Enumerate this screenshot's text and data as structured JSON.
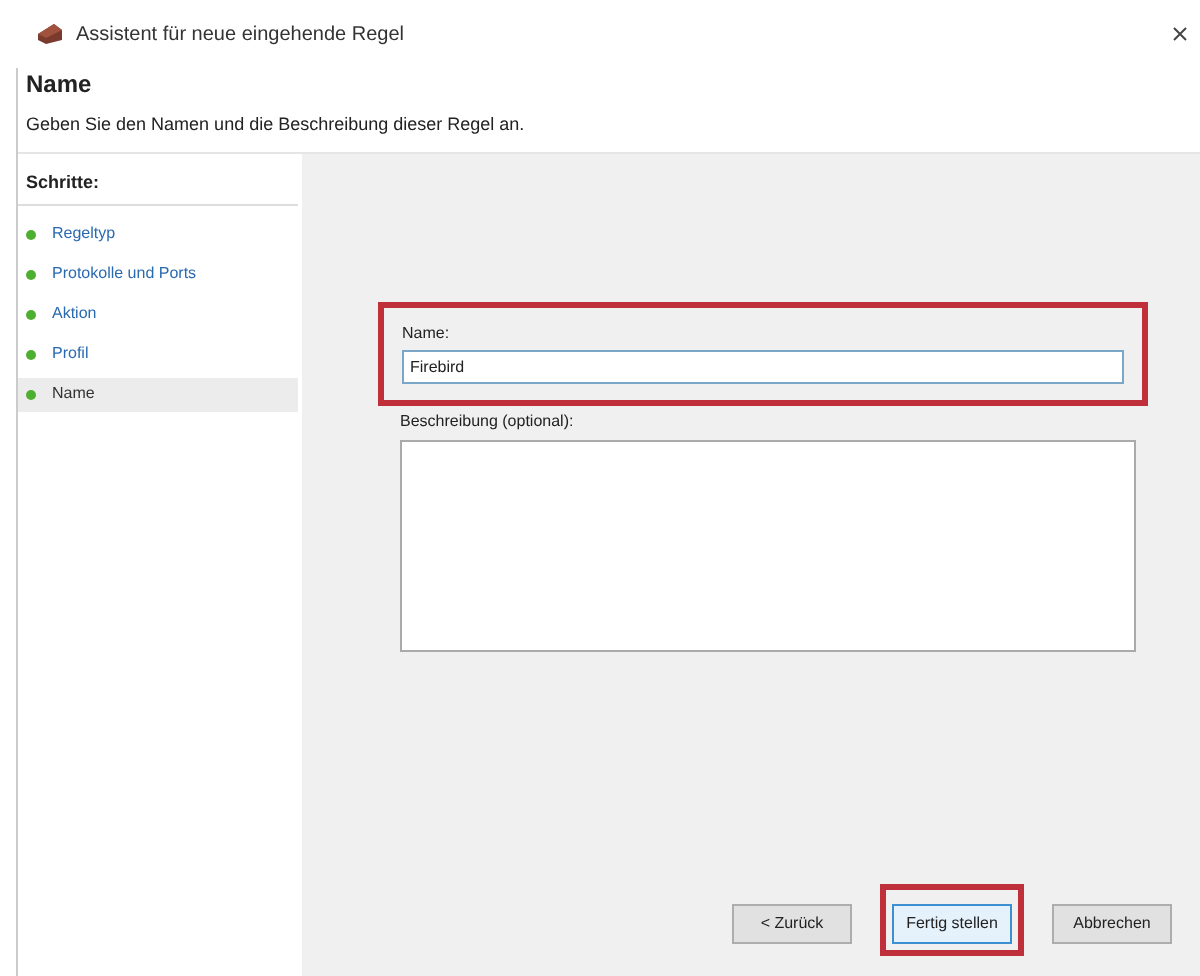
{
  "window": {
    "title": "Assistent für neue eingehende Regel"
  },
  "header": {
    "title": "Name",
    "description": "Geben Sie den Namen und die Beschreibung dieser Regel an."
  },
  "steps": {
    "title": "Schritte:",
    "items": [
      {
        "label": "Regeltyp",
        "selected": false
      },
      {
        "label": "Protokolle und Ports",
        "selected": false
      },
      {
        "label": "Aktion",
        "selected": false
      },
      {
        "label": "Profil",
        "selected": false
      },
      {
        "label": "Name",
        "selected": true
      }
    ]
  },
  "name_field": {
    "label": "Name:",
    "value": "Firebird",
    "highlighted": true
  },
  "description_field": {
    "label": "Beschreibung (optional):"
  },
  "buttons": [
    {
      "label": "< Zurück",
      "highlighted": false
    },
    {
      "label": "Fertig stellen",
      "highlighted": true
    },
    {
      "label": "Abbrechen",
      "highlighted": false
    }
  ]
}
